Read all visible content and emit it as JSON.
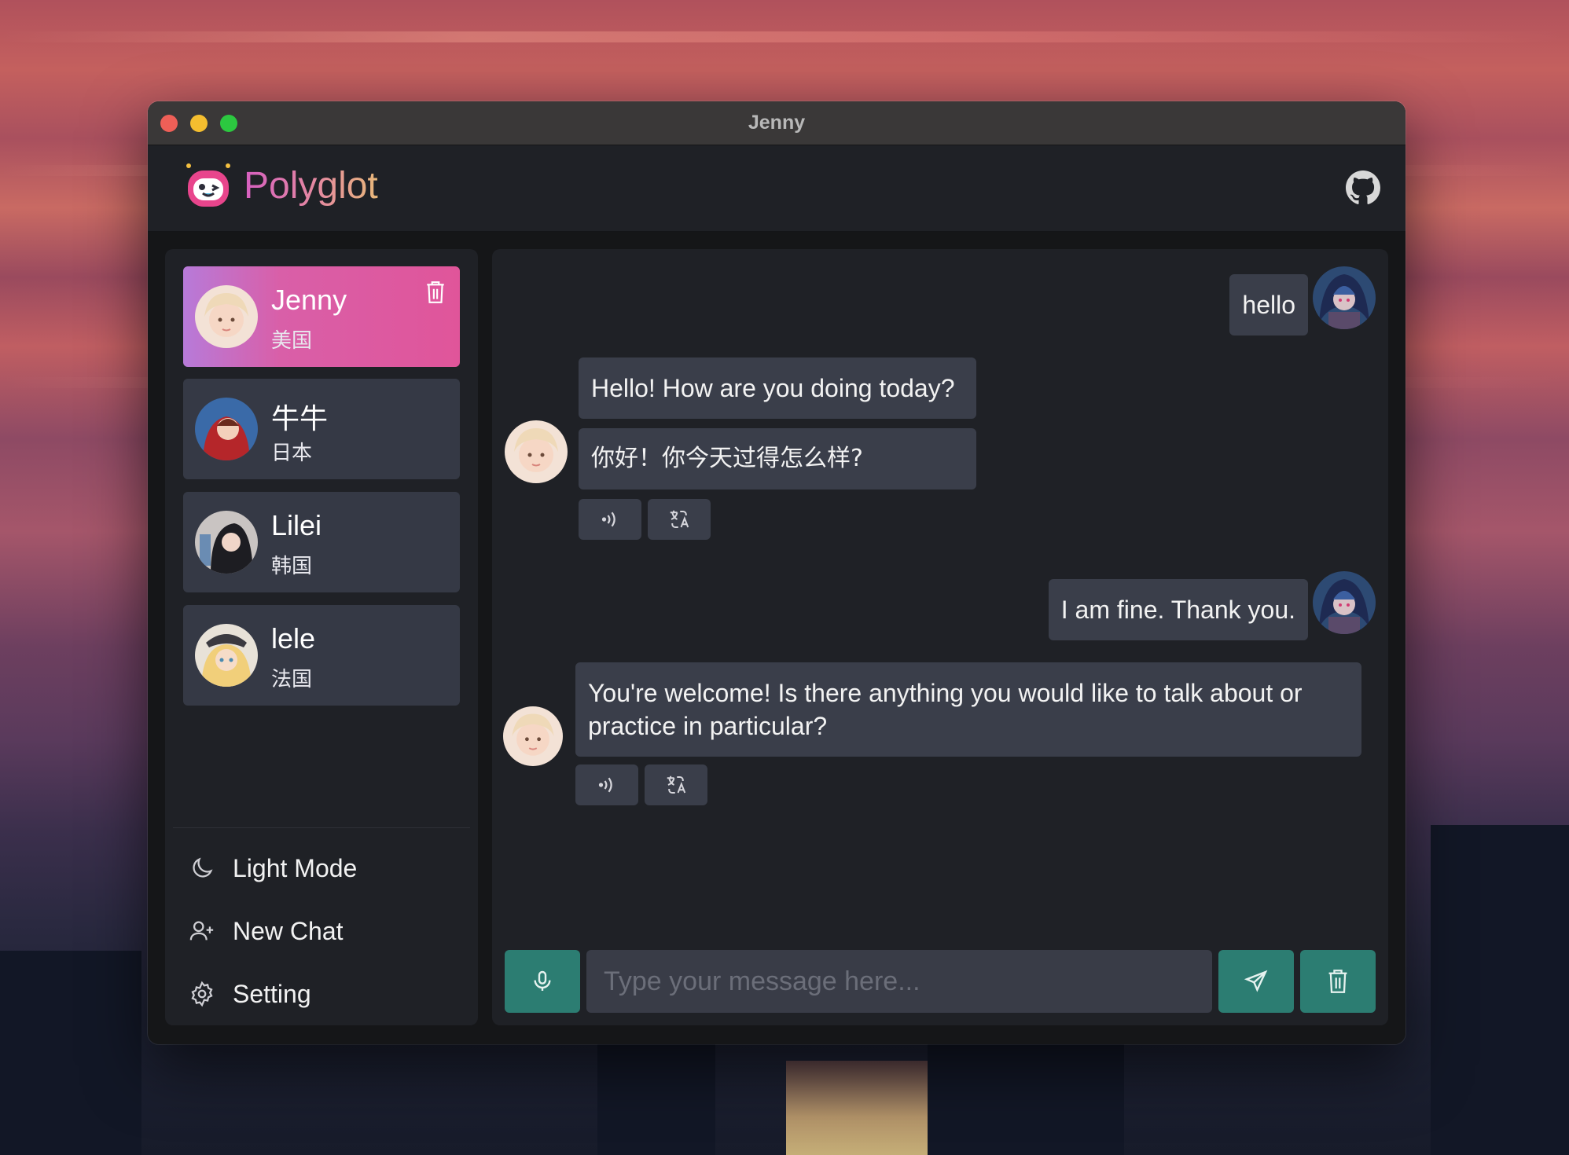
{
  "window": {
    "title": "Jenny"
  },
  "app": {
    "brand": "Polyglot",
    "github_icon": "github-icon"
  },
  "contacts": [
    {
      "name": "Jenny",
      "lang": "美国",
      "active": true
    },
    {
      "name": "牛牛",
      "lang": "日本",
      "active": false
    },
    {
      "name": "Lilei",
      "lang": "韩国",
      "active": false
    },
    {
      "name": "lele",
      "lang": "法国",
      "active": false
    }
  ],
  "menu": {
    "light_mode": "Light Mode",
    "new_chat": "New Chat",
    "setting": "Setting"
  },
  "messages": [
    {
      "role": "user",
      "text": "hello"
    },
    {
      "role": "assistant",
      "text": "Hello! How are you doing today?",
      "translation": "你好！你今天过得怎么样?"
    },
    {
      "role": "user",
      "text": "I am fine. Thank you."
    },
    {
      "role": "assistant",
      "text": "You're welcome! Is there anything you would like to talk about or practice in particular?"
    }
  ],
  "composer": {
    "placeholder": "Type your message here..."
  },
  "colors": {
    "accent": "#2c7d72",
    "active_contact": "#e0559a",
    "bubble": "#3a3e4a"
  }
}
